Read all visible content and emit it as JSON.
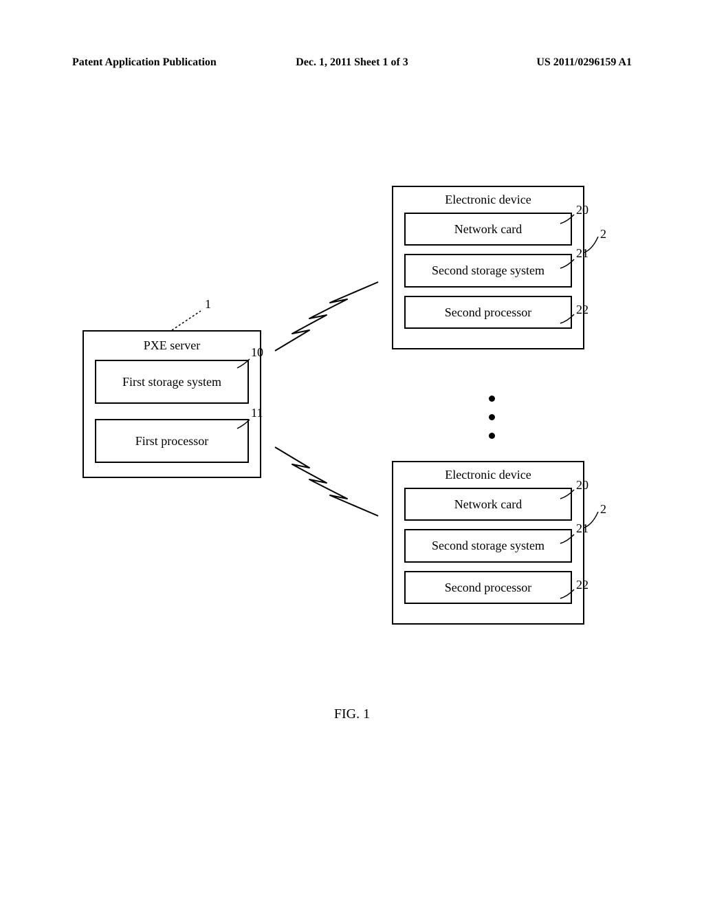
{
  "header": {
    "left": "Patent Application Publication",
    "center": "Dec. 1, 2011   Sheet 1 of 3",
    "right": "US 2011/0296159 A1"
  },
  "server": {
    "title": "PXE server",
    "box1": "First storage system",
    "box2": "First processor",
    "ref": "1",
    "ref1": "10",
    "ref2": "11"
  },
  "device": {
    "title": "Electronic device",
    "box1": "Network card",
    "box2": "Second storage system",
    "box3": "Second processor",
    "ref": "2",
    "ref1": "20",
    "ref2": "21",
    "ref3": "22"
  },
  "figure": "FIG. 1"
}
